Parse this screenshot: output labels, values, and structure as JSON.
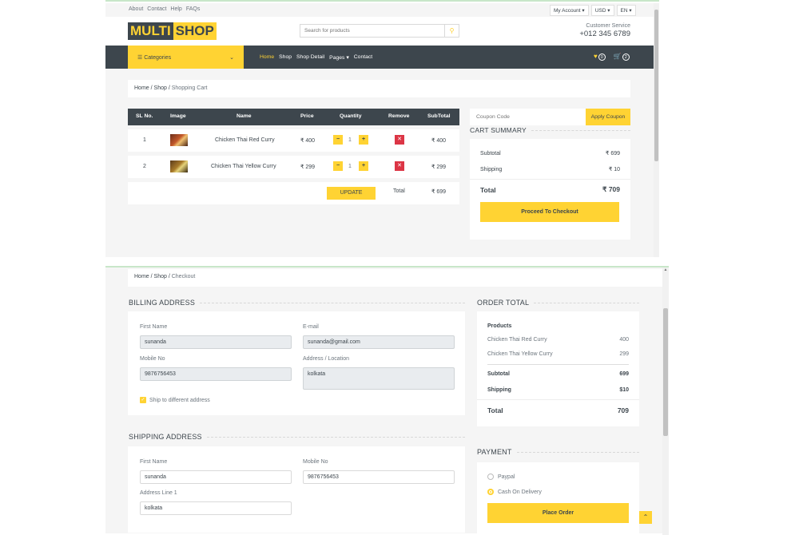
{
  "topbar": {
    "links": [
      "About",
      "Contact",
      "Help",
      "FAQs"
    ],
    "account": "My Account",
    "currency": "USD",
    "language": "EN"
  },
  "logo": {
    "part1": "MULTI",
    "part2": "SHOP"
  },
  "search": {
    "placeholder": "Search for products"
  },
  "customer_service": {
    "label": "Customer Service",
    "phone": "+012 345 6789"
  },
  "nav": {
    "categories": "Categories",
    "items": [
      "Home",
      "Shop",
      "Shop Detail",
      "Pages",
      "Contact"
    ],
    "wishlist_count": "0",
    "cart_count": "2"
  },
  "cart_breadcrumb": [
    "Home",
    "Shop",
    "Shopping Cart"
  ],
  "cart_table": {
    "headers": [
      "SL No.",
      "Image",
      "Name",
      "Price",
      "Quantity",
      "Remove",
      "SubTotal"
    ],
    "rows": [
      {
        "sl": "1",
        "name": "Chicken Thai Red Curry",
        "price": "₹ 400",
        "qty": "1",
        "subtotal": "₹ 400"
      },
      {
        "sl": "2",
        "name": "Chicken Thai Yellow Curry",
        "price": "₹ 299",
        "qty": "1",
        "subtotal": "₹ 299"
      }
    ],
    "update_label": "UPDATE",
    "total_label": "Total",
    "total_value": "₹ 699"
  },
  "coupon": {
    "placeholder": "Coupon Code",
    "button": "Apply Coupon"
  },
  "cart_summary": {
    "title": "CART SUMMARY",
    "subtotal_label": "Subtotal",
    "subtotal_value": "₹ 699",
    "shipping_label": "Shipping",
    "shipping_value": "₹ 10",
    "total_label": "Total",
    "total_value": "₹ 709",
    "checkout_label": "Proceed To Checkout"
  },
  "checkout_breadcrumb": [
    "Home",
    "Shop",
    "Checkout"
  ],
  "billing": {
    "title": "BILLING ADDRESS",
    "first_name_label": "First Name",
    "first_name_value": "sunanda",
    "email_label": "E-mail",
    "email_value": "sunanda@gmail.com",
    "mobile_label": "Mobile No",
    "mobile_value": "9876756453",
    "address_label": "Address / Location",
    "address_value": "kolkata",
    "ship_diff_label": "Ship to different address"
  },
  "shipping_address": {
    "title": "SHIPPING ADDRESS",
    "first_name_label": "First Name",
    "first_name_value": "sunanda",
    "mobile_label": "Mobile No",
    "mobile_value": "9876756453",
    "address_label": "Address Line 1",
    "address_value": "kolkata"
  },
  "order_total": {
    "title": "ORDER TOTAL",
    "products_label": "Products",
    "items": [
      {
        "name": "Chicken Thai Red Curry",
        "price": "400"
      },
      {
        "name": "Chicken Thai Yellow Curry",
        "price": "299"
      }
    ],
    "subtotal_label": "Subtotal",
    "subtotal_value": "699",
    "shipping_label": "Shipping",
    "shipping_value": "$10",
    "total_label": "Total",
    "total_value": "709"
  },
  "payment": {
    "title": "PAYMENT",
    "options": [
      "Paypal",
      "Cash On Delivery"
    ],
    "selected": "Cash On Delivery",
    "place_order": "Place Order"
  },
  "colors": {
    "accent": "#ffd333",
    "dark": "#3d464d",
    "panel": "#f5f5f5",
    "remove": "#dc3545"
  }
}
